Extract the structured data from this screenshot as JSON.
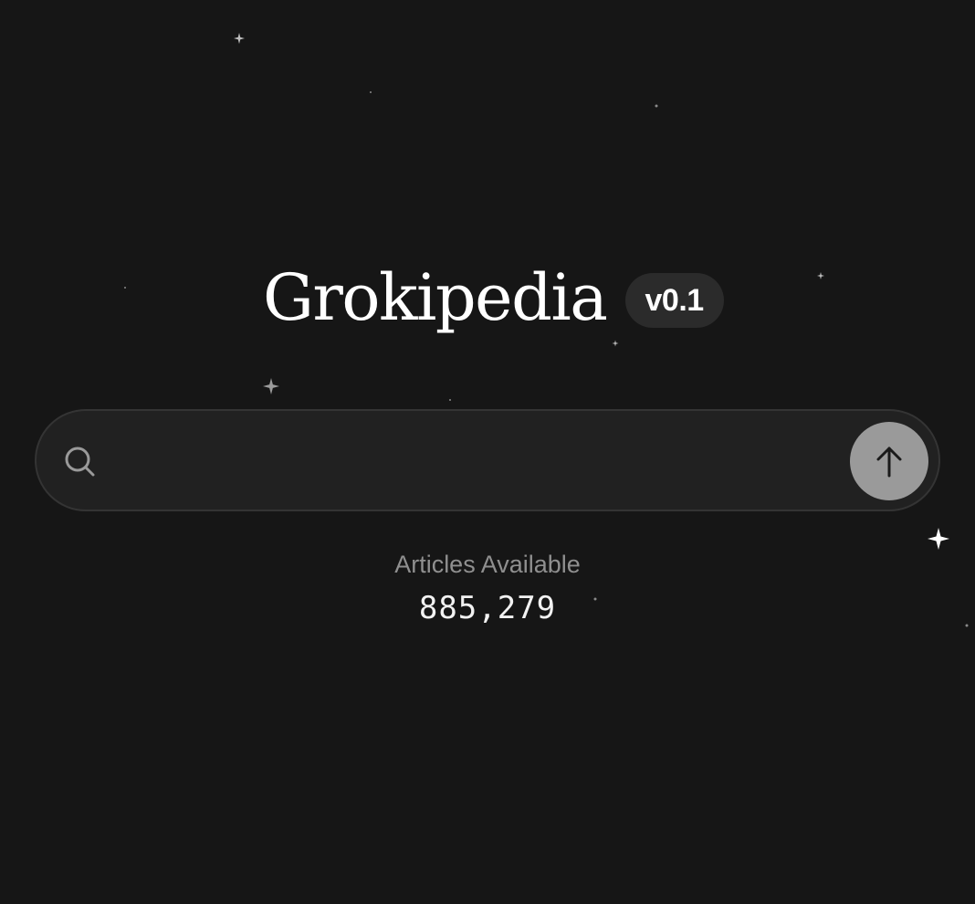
{
  "header": {
    "title": "Grokipedia",
    "version_badge": "v0.1"
  },
  "search": {
    "placeholder": "",
    "value": "",
    "search_icon": "search-icon",
    "submit_icon": "arrow-up-icon"
  },
  "stats": {
    "label": "Articles Available",
    "count": "885,279"
  },
  "colors": {
    "background": "#161616",
    "search_bar": "#212121",
    "submit_button": "#9a9a9a",
    "badge": "#2b2b2b"
  }
}
